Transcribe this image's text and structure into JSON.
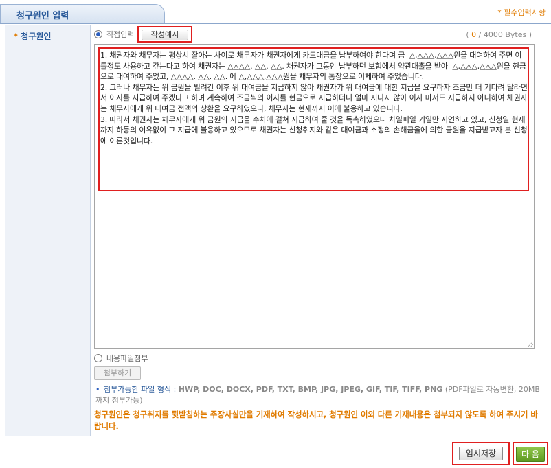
{
  "header": {
    "title": "청구원인 입력",
    "required_note": "* 필수입력사항"
  },
  "label": {
    "star": "*",
    "text": "청구원인"
  },
  "input_mode": {
    "direct_label": "직접입력",
    "example_button": "작성예시",
    "byte_count": "0",
    "byte_max": "/ 4000 Bytes )",
    "byte_open": "("
  },
  "textarea": {
    "content": "1. 채권자와 채무자는 평상시 잘아는 사이로 채무자가 채권자에게 카드대금을 납부하여야 한다며 금  △,△△△,△△△원을 대여하여 주면 이틀정도 사용하고 갚는다고 하여 채권자는 △△△△. △△. △△. 채권자가 그동안 납부하던 보험에서 약관대출을 받아  △,△△△,△△△원을 현금으로 대여하여 주었고, △△△△. △△. △△. 에 △,△△△,△△△원을 채무자의 통장으로 이체하여 주었습니다.\n2. 그러나 채무자는 위 금원을 빌려간 이후 위 대여금을 지급하지 않아 채권자가 위 대여금에 대한 지급을 요구하자 조금만 더 기다려 달라면서 이자를 지급하여 주겠다고 하며 계속하여 조금씩의 이자를 현금으로 지급하더니 얼마 지나지 않아 이자 마저도 지급하지 아니하여 채권자는 채무자에게 위 대여금 전액의 상환을 요구하였으나, 채무자는 현재까지 이에 불응하고 있습니다.\n3. 따라서 채권자는 채무자에게 위 금원의 지급을 수차에 걸쳐 지급하여 줄 것을 독촉하였으나 차일피일 기일만 지연하고 있고, 신청일 현재까지 하등의 이유없이 그 지급에 불응하고 있으므로 채권자는 신청취지와 같은 대여금과 소정의 손해금율에 의한 금원을 지급받고자 본 신청에 이른것입니다."
  },
  "attachment": {
    "radio_label": "내용파일첨부",
    "attach_button": "첨부하기",
    "bullet": "•",
    "formats_lead": "첨부가능한 파일 형식 :",
    "formats": "HWP, DOC, DOCX, PDF, TXT, BMP, JPG, JPEG, GIF, TIF, TIFF, PNG",
    "formats_note": "(PDF파일로 자동변환, 20MB까지 첨부가능)"
  },
  "warning": "청구원인은 청구취지를 뒷받침하는 주장사실만을 기재하여 작성하시고, 청구원인 이외 다른 기재내용은 첨부되지 않도록 하여 주시기 바랍니다.",
  "buttons": {
    "save": "임시저장",
    "next": "다 음"
  }
}
